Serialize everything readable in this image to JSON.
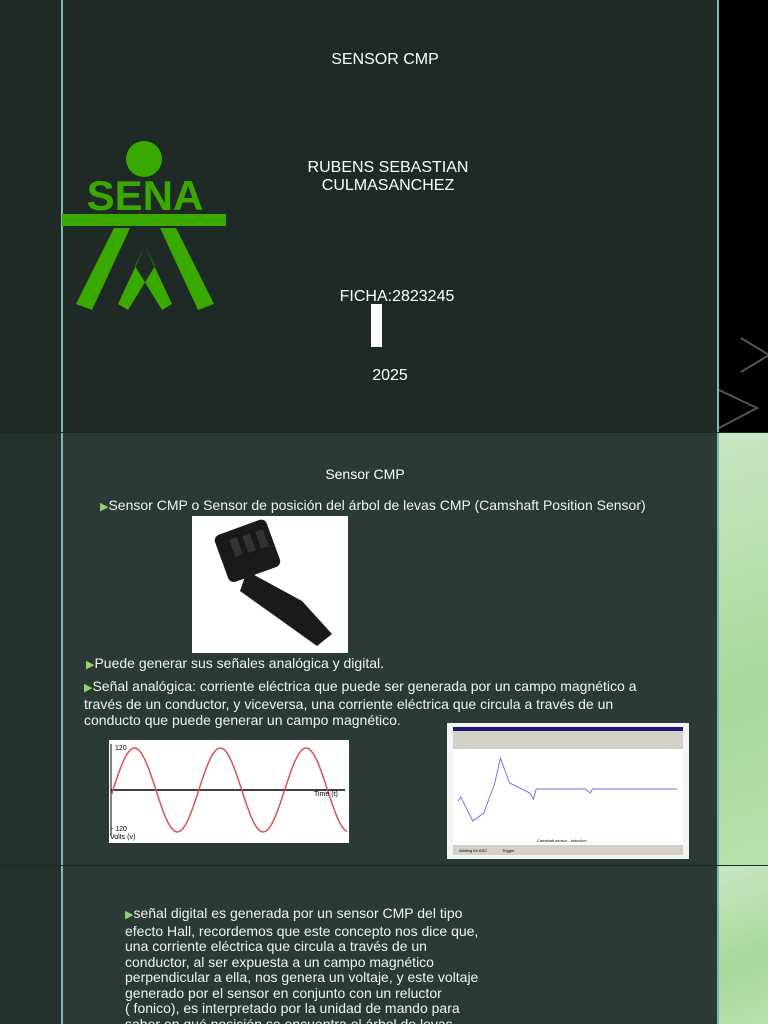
{
  "slide1": {
    "title": "SENSOR CMP",
    "author_line1": "RUBENS SEBASTIAN",
    "author_line2": "CULMASANCHEZ",
    "ficha": "FICHA:2823245",
    "year": "2025",
    "logo_text": "SENA",
    "logo_color": "#39a900"
  },
  "slide2": {
    "title": "Sensor CMP",
    "bullet1": "Sensor CMP o Sensor de posición del árbol de levas CMP (Camshaft Position Sensor)",
    "bullet2": "Puede generar sus señales analógica y digital.",
    "bullet3_l1": "Señal analógica: corriente eléctrica que puede ser generada por un campo magnético a",
    "bullet3_l2": "través de un conductor, y viceversa, una corriente eléctrica que circula a través de un",
    "bullet3_l3": "conducto que puede generar un campo magnético.",
    "sine": {
      "top": "120",
      "bottom": "- 120",
      "axis": "Time (t)",
      "ylabel": "Volts (v)"
    },
    "scope": {
      "xlabel": "Camshaft sensor - inductive",
      "status": "Waiting for ASC",
      "trigger": "Trigger"
    }
  },
  "slide3": {
    "lines": [
      "señal digital es generada por un sensor CMP del tipo",
      "efecto Hall, recordemos que este concepto nos dice que,",
      "una corriente eléctrica que circula a través de un",
      "conductor, al ser expuesta a un campo magnético",
      "perpendicular a ella, nos genera un voltaje, y este voltaje",
      "generado por el sensor en conjunto con un reluctor",
      "( fonico), es interpretado por la unidad de mando para",
      "saber en qué posición se encuentra el árbol de levas."
    ]
  }
}
